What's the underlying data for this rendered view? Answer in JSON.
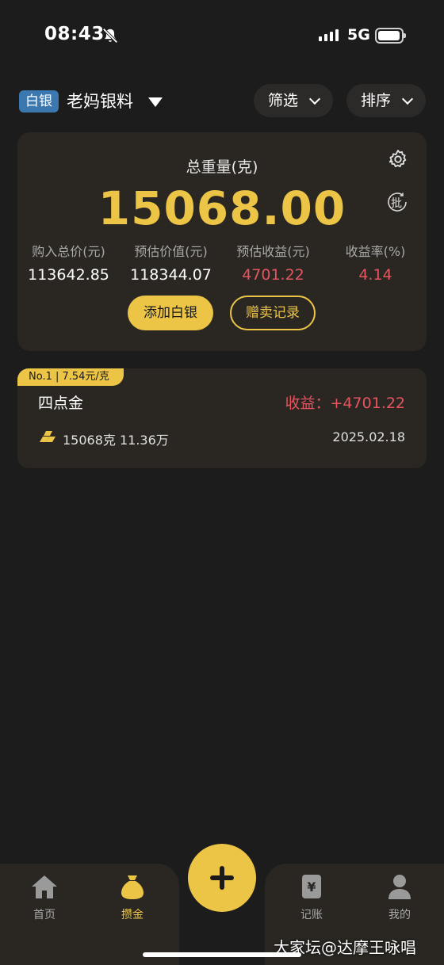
{
  "status_bar": {
    "time": "08:43",
    "network": "5G"
  },
  "header": {
    "tag": "白银",
    "account_name": "老妈银料",
    "filter_label": "筛选",
    "sort_label": "排序"
  },
  "summary": {
    "total_label": "总重量(克)",
    "total_value": "15068.00",
    "batch_label": "批",
    "stats": [
      {
        "label": "购入总价(元)",
        "value": "113642.85"
      },
      {
        "label": "预估价值(元)",
        "value": "118344.07"
      },
      {
        "label": "预估收益(元)",
        "value": "4701.22"
      },
      {
        "label": "收益率(%)",
        "value": "4.14"
      }
    ],
    "add_button": "添加白银",
    "record_button": "赠卖记录",
    "colors": {
      "accent": "#ecc547",
      "profit": "#e5555f"
    }
  },
  "items": [
    {
      "rank_tag": "No.1 | 7.54元/克",
      "name": "四点金",
      "profit": "收益：+4701.22",
      "quantity": "15068克 11.36万",
      "date": "2025.02.18"
    }
  ],
  "bottom_nav": {
    "items": [
      {
        "label": "首页",
        "icon": "home-icon"
      },
      {
        "label": "攒金",
        "icon": "money-bag-icon"
      },
      {
        "label": "记账",
        "icon": "ledger-icon"
      },
      {
        "label": "我的",
        "icon": "user-icon"
      }
    ],
    "active": "攒金"
  },
  "watermark": "大家坛@达摩王咏唱"
}
